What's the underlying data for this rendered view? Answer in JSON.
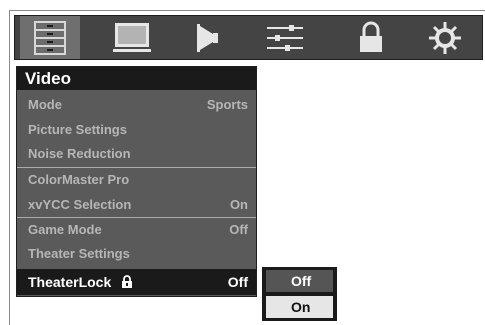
{
  "toolbar": {
    "icons": [
      {
        "name": "list-menu-icon",
        "selected": true
      },
      {
        "name": "picture-icon",
        "selected": false
      },
      {
        "name": "audio-icon",
        "selected": false
      },
      {
        "name": "setup-sliders-icon",
        "selected": false
      },
      {
        "name": "lock-icon",
        "selected": false
      },
      {
        "name": "gear-icon",
        "selected": false
      }
    ]
  },
  "menu": {
    "title": "Video",
    "items": [
      {
        "label": "Mode",
        "value": "Sports"
      },
      {
        "label": "Picture Settings",
        "value": ""
      },
      {
        "label": "Noise Reduction",
        "value": ""
      },
      {
        "label": "ColorMaster Pro",
        "value": ""
      },
      {
        "label": "xvYCC Selection",
        "value": "On"
      },
      {
        "label": "Game Mode",
        "value": "Off"
      },
      {
        "label": "Theater Settings",
        "value": ""
      },
      {
        "label": "TheaterLock",
        "value": "Off"
      }
    ]
  },
  "dropdown": {
    "options": [
      "Off",
      "On"
    ],
    "selected": "Off"
  },
  "colors": {
    "toolbar_bg": "#444444",
    "panel_bg": "#5a5a5a",
    "highlight_bg": "#1a1a1a",
    "dim_text": "#b6b6b6"
  }
}
